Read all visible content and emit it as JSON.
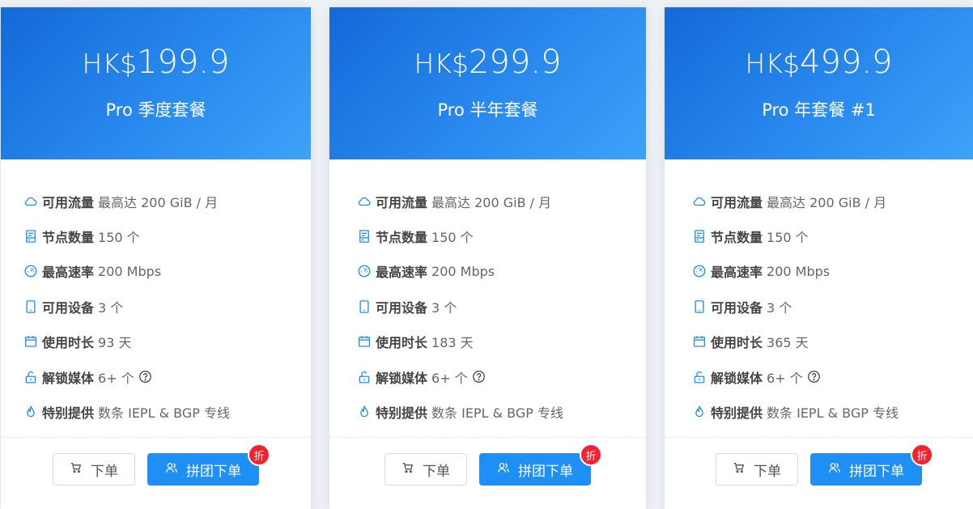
{
  "plans": [
    {
      "currency": "HK$",
      "price": "199.9",
      "name": "Pro 季度套餐",
      "features": [
        {
          "icon": "cloud-icon",
          "label": "可用流量",
          "value": "最高达 200 GiB / 月"
        },
        {
          "icon": "server-icon",
          "label": "节点数量",
          "value": "150 个"
        },
        {
          "icon": "speedometer-icon",
          "label": "最高速率",
          "value": "200 Mbps"
        },
        {
          "icon": "tablet-icon",
          "label": "可用设备",
          "value": "3 个"
        },
        {
          "icon": "calendar-icon",
          "label": "使用时长",
          "value": "93 天"
        },
        {
          "icon": "unlock-icon",
          "label": "解锁媒体",
          "value": "6+ 个"
        },
        {
          "icon": "flame-icon",
          "label": "特别提供",
          "value": "数条 IEPL & BGP 专线"
        }
      ],
      "order_label": "下单",
      "group_label": "拼团下单",
      "badge": "折"
    },
    {
      "currency": "HK$",
      "price": "299.9",
      "name": "Pro 半年套餐",
      "features": [
        {
          "icon": "cloud-icon",
          "label": "可用流量",
          "value": "最高达 200 GiB / 月"
        },
        {
          "icon": "server-icon",
          "label": "节点数量",
          "value": "150 个"
        },
        {
          "icon": "speedometer-icon",
          "label": "最高速率",
          "value": "200 Mbps"
        },
        {
          "icon": "tablet-icon",
          "label": "可用设备",
          "value": "3 个"
        },
        {
          "icon": "calendar-icon",
          "label": "使用时长",
          "value": "183 天"
        },
        {
          "icon": "unlock-icon",
          "label": "解锁媒体",
          "value": "6+ 个"
        },
        {
          "icon": "flame-icon",
          "label": "特别提供",
          "value": "数条 IEPL & BGP 专线"
        }
      ],
      "order_label": "下单",
      "group_label": "拼团下单",
      "badge": "折"
    },
    {
      "currency": "HK$",
      "price": "499.9",
      "name": "Pro 年套餐 #1",
      "features": [
        {
          "icon": "cloud-icon",
          "label": "可用流量",
          "value": "最高达 200 GiB / 月"
        },
        {
          "icon": "server-icon",
          "label": "节点数量",
          "value": "150 个"
        },
        {
          "icon": "speedometer-icon",
          "label": "最高速率",
          "value": "200 Mbps"
        },
        {
          "icon": "tablet-icon",
          "label": "可用设备",
          "value": "3 个"
        },
        {
          "icon": "calendar-icon",
          "label": "使用时长",
          "value": "365 天"
        },
        {
          "icon": "unlock-icon",
          "label": "解锁媒体",
          "value": "6+ 个"
        },
        {
          "icon": "flame-icon",
          "label": "特别提供",
          "value": "数条 IEPL & BGP 专线"
        }
      ],
      "order_label": "下单",
      "group_label": "拼团下单",
      "badge": "折"
    }
  ],
  "colors": {
    "header_gradient_start": "#1469d8",
    "header_gradient_end": "#3ea2f7",
    "icon_blue": "#1e90f5",
    "primary_button": "#1e90f5",
    "badge_red": "#f5222d"
  }
}
